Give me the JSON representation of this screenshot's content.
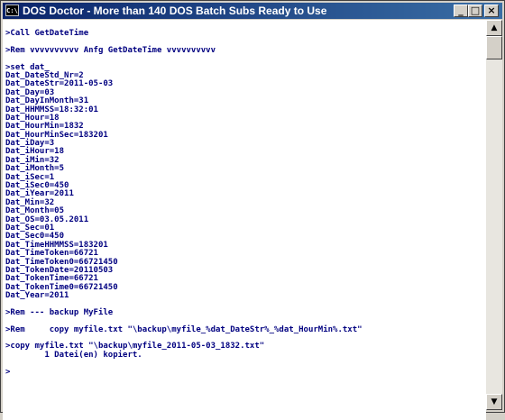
{
  "window": {
    "title": "DOS Doctor - More than 140 DOS Batch Subs Ready to Use",
    "icon_label": "C:\\",
    "buttons": {
      "minimize": "_",
      "maximize": "□",
      "close": "×"
    }
  },
  "scrollbar": {
    "up_arrow": "▲",
    "down_arrow": "▼"
  },
  "console_lines": [
    ">Call GetDateTime",
    "",
    ">Rem vvvvvvvvvv Anfg GetDateTime vvvvvvvvvv",
    "",
    ">set dat_",
    "Dat_DateStd_Nr=2",
    "Dat_DateStr=2011-05-03",
    "Dat_Day=03",
    "Dat_DayInMonth=31",
    "Dat_HHMMSS=18:32:01",
    "Dat_Hour=18",
    "Dat_HourMin=1832",
    "Dat_HourMinSec=183201",
    "Dat_iDay=3",
    "Dat_iHour=18",
    "Dat_iMin=32",
    "Dat_iMonth=5",
    "Dat_iSec=1",
    "Dat_iSec0=450",
    "Dat_iYear=2011",
    "Dat_Min=32",
    "Dat_Month=05",
    "Dat_OS=03.05.2011",
    "Dat_Sec=01",
    "Dat_Sec0=450",
    "Dat_TimeHHMMSS=183201",
    "Dat_TimeToken=66721",
    "Dat_TimeToken0=66721450",
    "Dat_TokenDate=20110503",
    "Dat_TokenTime=66721",
    "Dat_TokenTime0=66721450",
    "Dat_Year=2011",
    "",
    ">Rem --- backup MyFile",
    "",
    ">Rem     copy myfile.txt \"\\backup\\myfile_%dat_DateStr%_%dat_HourMin%.txt\"",
    "",
    ">copy myfile.txt \"\\backup\\myfile_2011-05-03_1832.txt\"",
    "        1 Datei(en) kopiert.",
    "",
    ">"
  ]
}
